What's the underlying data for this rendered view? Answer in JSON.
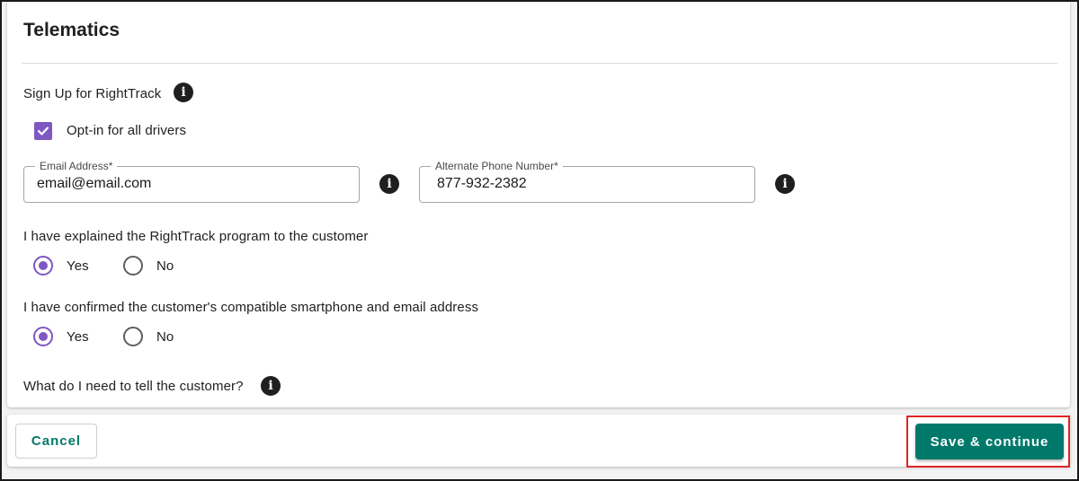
{
  "section": {
    "title": "Telematics"
  },
  "signup": {
    "label": "Sign Up for RightTrack",
    "info_icon": "info-icon"
  },
  "opt_in": {
    "label": "Opt-in for all drivers",
    "checked": true,
    "color": "#7e57c2"
  },
  "email": {
    "label": "Email Address*",
    "value": "email@email.com"
  },
  "phone": {
    "label": "Alternate Phone Number*",
    "value": "877-932-2382"
  },
  "question1": {
    "label": "I have explained the RightTrack program to the customer",
    "yes_label": "Yes",
    "no_label": "No",
    "selected": "Yes"
  },
  "question2": {
    "label": "I have confirmed the customer's compatible smartphone and email address",
    "yes_label": "Yes",
    "no_label": "No",
    "selected": "Yes"
  },
  "tell_customer": {
    "label": "What do I need to tell the customer?"
  },
  "footer": {
    "cancel_label": "Cancel",
    "save_label": "Save & continue",
    "accent_color": "#00796b",
    "highlight_color": "#e02424"
  }
}
